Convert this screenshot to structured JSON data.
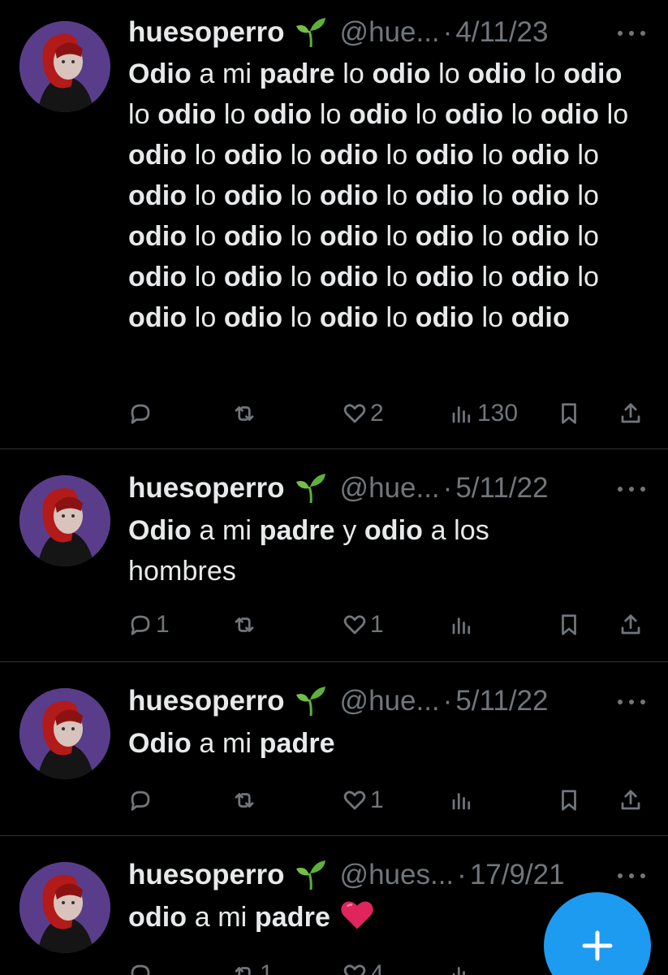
{
  "tweets": [
    {
      "name": "huesoperro",
      "handle": "@hue...",
      "date": "4/11/23",
      "text": [
        {
          "b": true,
          "t": "Odio"
        },
        {
          "b": false,
          "t": " a mi "
        },
        {
          "b": true,
          "t": "padre"
        },
        {
          "b": false,
          "t": " lo "
        },
        {
          "b": true,
          "t": "odio"
        },
        {
          "b": false,
          "t": " lo "
        },
        {
          "b": true,
          "t": "odio"
        },
        {
          "b": false,
          "t": " lo "
        },
        {
          "b": true,
          "t": "odio"
        },
        {
          "b": false,
          "t": " lo "
        },
        {
          "b": true,
          "t": "odio"
        },
        {
          "b": false,
          "t": " lo "
        },
        {
          "b": true,
          "t": "odio"
        },
        {
          "b": false,
          "t": " lo "
        },
        {
          "b": true,
          "t": "odio"
        },
        {
          "b": false,
          "t": " lo "
        },
        {
          "b": true,
          "t": "odio"
        },
        {
          "b": false,
          "t": " lo "
        },
        {
          "b": true,
          "t": "odio"
        },
        {
          "b": false,
          "t": " lo "
        },
        {
          "b": true,
          "t": "odio"
        },
        {
          "b": false,
          "t": " lo "
        },
        {
          "b": true,
          "t": "odio"
        },
        {
          "b": false,
          "t": " lo "
        },
        {
          "b": true,
          "t": "odio"
        },
        {
          "b": false,
          "t": " lo "
        },
        {
          "b": true,
          "t": "odio"
        },
        {
          "b": false,
          "t": " lo "
        },
        {
          "b": true,
          "t": "odio"
        },
        {
          "b": false,
          "t": " lo "
        },
        {
          "b": true,
          "t": "odio"
        },
        {
          "b": false,
          "t": " lo "
        },
        {
          "b": true,
          "t": "odio"
        },
        {
          "b": false,
          "t": " lo "
        },
        {
          "b": true,
          "t": "odio"
        },
        {
          "b": false,
          "t": " lo "
        },
        {
          "b": true,
          "t": "odio"
        },
        {
          "b": false,
          "t": " lo "
        },
        {
          "b": true,
          "t": "odio"
        },
        {
          "b": false,
          "t": " lo "
        },
        {
          "b": true,
          "t": "odio"
        },
        {
          "b": false,
          "t": " lo "
        },
        {
          "b": true,
          "t": "odio"
        },
        {
          "b": false,
          "t": " lo "
        },
        {
          "b": true,
          "t": "odio"
        },
        {
          "b": false,
          "t": " lo "
        },
        {
          "b": true,
          "t": "odio"
        },
        {
          "b": false,
          "t": " lo "
        },
        {
          "b": true,
          "t": "odio"
        },
        {
          "b": false,
          "t": " lo "
        },
        {
          "b": true,
          "t": "odio"
        },
        {
          "b": false,
          "t": " lo "
        },
        {
          "b": true,
          "t": "odio"
        },
        {
          "b": false,
          "t": " lo "
        },
        {
          "b": true,
          "t": "odio"
        },
        {
          "b": false,
          "t": " lo "
        },
        {
          "b": true,
          "t": "odio"
        },
        {
          "b": false,
          "t": " lo "
        },
        {
          "b": true,
          "t": "odio"
        },
        {
          "b": false,
          "t": " lo "
        },
        {
          "b": true,
          "t": "odio"
        },
        {
          "b": false,
          "t": " lo "
        },
        {
          "b": true,
          "t": "odio"
        },
        {
          "b": false,
          "t": " lo "
        },
        {
          "b": true,
          "t": "odio"
        },
        {
          "b": false,
          "t": " lo "
        },
        {
          "b": true,
          "t": "odio"
        },
        {
          "b": false,
          "t": " lo "
        },
        {
          "b": true,
          "t": "odio"
        }
      ],
      "replies": "",
      "retweets": "",
      "likes": "2",
      "views": "130"
    },
    {
      "name": "huesoperro",
      "handle": "@hue...",
      "date": "5/11/22",
      "text": [
        {
          "b": true,
          "t": "Odio"
        },
        {
          "b": false,
          "t": " a mi "
        },
        {
          "b": true,
          "t": "padre"
        },
        {
          "b": false,
          "t": " y "
        },
        {
          "b": true,
          "t": "odio"
        },
        {
          "b": false,
          "t": " a los hombres"
        }
      ],
      "replies": "1",
      "retweets": "",
      "likes": "1",
      "views": ""
    },
    {
      "name": "huesoperro",
      "handle": "@hue...",
      "date": "5/11/22",
      "text": [
        {
          "b": true,
          "t": "Odio"
        },
        {
          "b": false,
          "t": " a mi "
        },
        {
          "b": true,
          "t": "padre"
        }
      ],
      "replies": "",
      "retweets": "",
      "likes": "1",
      "views": ""
    },
    {
      "name": "huesoperro",
      "handle": "@hues...",
      "date": "17/9/21",
      "text": [
        {
          "b": true,
          "t": "odio"
        },
        {
          "b": false,
          "t": " a mi "
        },
        {
          "b": true,
          "t": "padre"
        }
      ],
      "replies": "",
      "retweets": "1",
      "likes": "4",
      "views": ""
    }
  ],
  "separator": "·",
  "colors": {
    "background": "#000000",
    "text": "#e7e9ea",
    "muted": "#71767b",
    "divider": "#2f3336",
    "accent": "#1d9bf0",
    "heart": "#e0245e"
  },
  "icons": [
    "avatar",
    "sprout-emoji",
    "more-icon",
    "reply-icon",
    "retweet-icon",
    "like-icon",
    "views-icon",
    "bookmark-icon",
    "share-icon",
    "red-heart-emoji",
    "compose-plus-icon"
  ]
}
